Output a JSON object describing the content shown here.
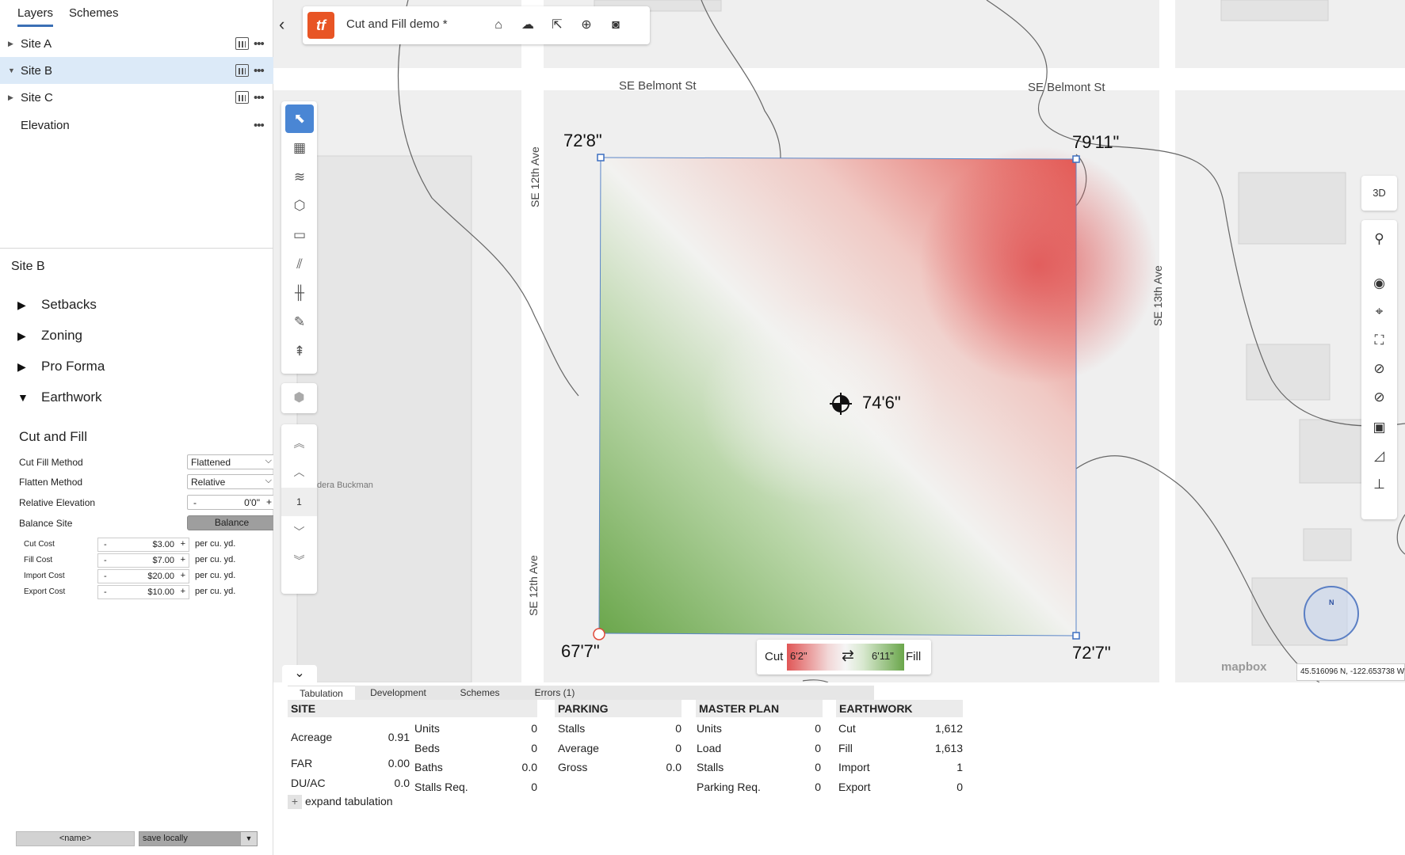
{
  "left_panel": {
    "tabs": [
      "Layers",
      "Schemes"
    ],
    "layers": [
      {
        "label": "Site A"
      },
      {
        "label": "Site B"
      },
      {
        "label": "Site C"
      },
      {
        "label": "Elevation"
      }
    ],
    "site_title": "Site B",
    "sections": [
      "Setbacks",
      "Zoning",
      "Pro Forma",
      "Earthwork"
    ],
    "cut_fill": {
      "title": "Cut and Fill",
      "cut_fill_method_label": "Cut Fill Method",
      "cut_fill_method_value": "Flattened",
      "flatten_method_label": "Flatten Method",
      "flatten_method_value": "Relative",
      "relative_elevation_label": "Relative Elevation",
      "relative_elevation_value": "0'0\"",
      "balance_site_label": "Balance Site",
      "balance_button": "Balance",
      "costs": [
        {
          "label": "Cut Cost",
          "value": "$3.00",
          "unit": "per cu. yd."
        },
        {
          "label": "Fill Cost",
          "value": "$7.00",
          "unit": "per cu. yd."
        },
        {
          "label": "Import Cost",
          "value": "$20.00",
          "unit": "per cu. yd."
        },
        {
          "label": "Export Cost",
          "value": "$10.00",
          "unit": "per cu. yd."
        }
      ],
      "minus": "-",
      "plus": "+"
    },
    "name_placeholder": "<name>",
    "save_option": "save locally"
  },
  "header": {
    "logo_text": "tf",
    "title": "Cut and Fill demo *",
    "icons": [
      "home-icon",
      "cloud-upload-icon",
      "share-icon",
      "add-icon",
      "camera-icon"
    ]
  },
  "map": {
    "streets": {
      "belmont_1": "SE Belmont St",
      "belmont_2": "SE Belmont St",
      "twelfth_1": "SE 12th Ave",
      "twelfth_2": "SE 12th Ave",
      "thirteenth": "SE 13th Ave"
    },
    "poi": "dera Buckman",
    "elevations": {
      "top_left": "72'8\"",
      "top_right": "79'11\"",
      "bottom_left": "67'7\"",
      "bottom_right": "72'7\"",
      "center": "74'6\""
    },
    "legend": {
      "cut_label": "Cut",
      "cut_value": "6'2\"",
      "fill_label": "Fill",
      "fill_value": "6'11\""
    },
    "page_number": "1",
    "view_3d": "3D",
    "compass_n": "N",
    "attribution": "mapbox",
    "coordinates": "45.516096 N, -122.653738 W"
  },
  "tabulation": {
    "tabs": [
      "Tabulation",
      "Development",
      "Schemes",
      "Errors (1)"
    ],
    "site": {
      "header": "SITE",
      "rows": [
        {
          "k": "Acreage",
          "v": "0.91"
        },
        {
          "k": "FAR",
          "v": "0.00"
        },
        {
          "k": "DU/AC",
          "v": "0.0"
        }
      ],
      "rows2": [
        {
          "k": "Units",
          "v": "0"
        },
        {
          "k": "Beds",
          "v": "0"
        },
        {
          "k": "Baths",
          "v": "0.0"
        },
        {
          "k": "Stalls Req.",
          "v": "0"
        }
      ]
    },
    "parking": {
      "header": "PARKING",
      "rows": [
        {
          "k": "Stalls",
          "v": "0"
        },
        {
          "k": "Average",
          "v": "0"
        },
        {
          "k": "Gross",
          "v": "0.0"
        }
      ]
    },
    "master_plan": {
      "header": "MASTER PLAN",
      "rows": [
        {
          "k": "Units",
          "v": "0"
        },
        {
          "k": "Load",
          "v": "0"
        },
        {
          "k": "Stalls",
          "v": "0"
        },
        {
          "k": "Parking Req.",
          "v": "0"
        }
      ]
    },
    "earthwork": {
      "header": "EARTHWORK",
      "rows": [
        {
          "k": "Cut",
          "v": "1,612"
        },
        {
          "k": "Fill",
          "v": "1,613"
        },
        {
          "k": "Import",
          "v": "1"
        },
        {
          "k": "Export",
          "v": "0"
        }
      ]
    },
    "expand_label": "expand tabulation"
  }
}
